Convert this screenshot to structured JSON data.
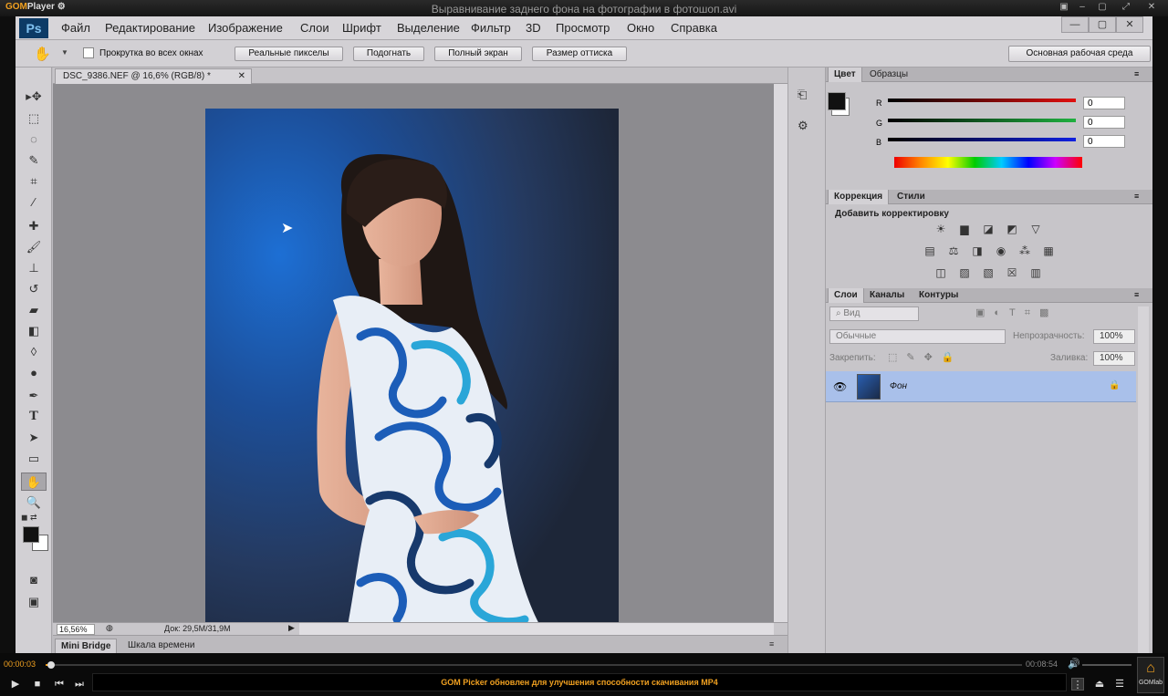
{
  "player": {
    "logo_gom": "GOM",
    "logo_player": "Player",
    "title": "Выравнивание заднего фона на фотографии в фотошоп.avi",
    "time_current": "00:00:03",
    "time_total": "00:08:54",
    "ticker": "GOM Picker обновлен для улучшения способности скачивания MP4",
    "gomlab": "GOMlab",
    "progress": 0.006
  },
  "ps": {
    "logo": "Ps",
    "menu": [
      "Файл",
      "Редактирование",
      "Изображение",
      "Слои",
      "Шрифт",
      "Выделение",
      "Фильтр",
      "3D",
      "Просмотр",
      "Окно",
      "Справка"
    ],
    "options": {
      "scroll_all_windows": "Прокрутка во всех окнах",
      "actual_pixels": "Реальные пикселы",
      "fit": "Подогнать",
      "full_screen": "Полный экран",
      "print_size": "Размер оттиска",
      "workspace": "Основная рабочая среда"
    },
    "document": {
      "tab": "DSC_9386.NEF @ 16,6% (RGB/8) *",
      "zoom": "16,56%",
      "doc_size": "Док: 29,5M/31,9M"
    },
    "bottom_tabs": [
      "Mini Bridge",
      "Шкала времени"
    ],
    "color_panel": {
      "tabs": [
        "Цвет",
        "Образцы"
      ],
      "channels": [
        {
          "label": "R",
          "value": "0",
          "color": "#e01010"
        },
        {
          "label": "G",
          "value": "0",
          "color": "#20b040"
        },
        {
          "label": "B",
          "value": "0",
          "color": "#1020e0"
        }
      ]
    },
    "adjustments": {
      "tabs": [
        "Коррекция",
        "Стили"
      ],
      "heading": "Добавить корректировку"
    },
    "layers": {
      "tabs": [
        "Слои",
        "Каналы",
        "Контуры"
      ],
      "kind_filter": "Вид",
      "blend_mode": "Обычные",
      "opacity_label": "Непрозрачность:",
      "opacity": "100%",
      "lock_label": "Закрепить:",
      "fill_label": "Заливка:",
      "fill": "100%",
      "layer_name": "Фон"
    }
  }
}
